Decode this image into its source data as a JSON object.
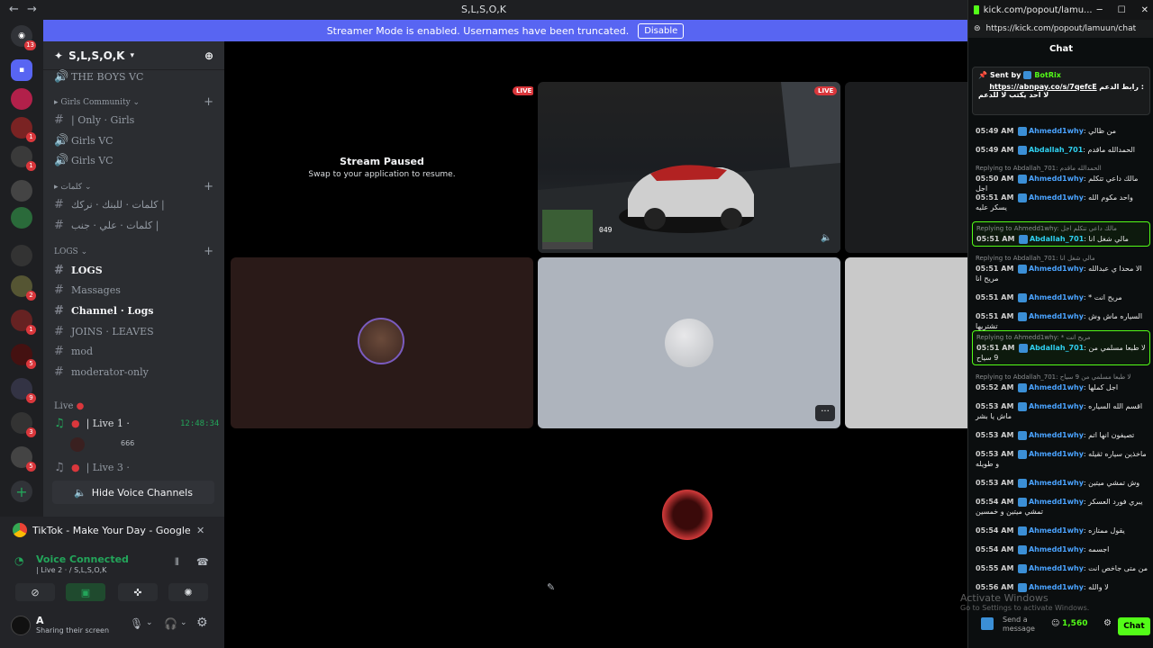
{
  "window": {
    "title": "S,L,S,O,K"
  },
  "banner": {
    "text": "Streamer Mode is enabled. Usernames have been truncated.",
    "button": "Disable"
  },
  "rail": {
    "badges": [
      "13",
      "1",
      "1",
      "1",
      "1",
      "2",
      "2",
      "1",
      "5",
      "9",
      "3",
      "5"
    ]
  },
  "server": {
    "name": "S,L,S,O,K"
  },
  "channels": {
    "boys_vc": "THE BOYS VC",
    "cat_girls": "Girls Community",
    "only_girls": "| Only · Girls",
    "girls_vc_1": "Girls VC",
    "girls_vc_2": "Girls VC",
    "cat_arabic": "كلمات",
    "arabic_1": "كلمات · للبنك · نركك |",
    "arabic_2": "كلمات · علي · جنب |",
    "cat_logs": "LOGS",
    "logs": "LOGS",
    "massages": "Massages",
    "channel_logs": "Channel · Logs",
    "joins": "JOINS · LEAVES",
    "mod": "mod",
    "moderator_only": "moderator-only",
    "cat_live": "Live",
    "live1": "| Live 1 ·",
    "live1_time": "12:48:34",
    "live1_user": "666",
    "live3": "| Live 3 ·",
    "hide_voice": "Hide Voice Channels"
  },
  "tiktok": {
    "text": "TikTok - Make Your Day - Google Ch..."
  },
  "voice": {
    "status": "Voice Connected",
    "channel": "| Live 2 · / S,L,S,O,K"
  },
  "user": {
    "name": "A",
    "status": "Sharing their screen"
  },
  "stage": {
    "paused_title": "Stream Paused",
    "paused_sub": "Swap to your application to resume.",
    "live": "LIVE",
    "speed": "049"
  },
  "kick": {
    "tab": "kick.com/popout/lamu...",
    "url": "https://kick.com/popout/lamuun/chat",
    "header": "Chat",
    "pinned_sent_by": "Sent by",
    "pinned_user": "BotRix",
    "pinned_link": "https://abnpay.co/s/7qefcE",
    "pinned_text1": "رابط الدعم :",
    "pinned_text2": "لا احد يكتب لا للدعم",
    "messages": [
      {
        "time": "05:49 AM",
        "user": "Ahmedd1why",
        "text": "من ظالي"
      },
      {
        "time": "05:49 AM",
        "user": "Abdallah_701",
        "text": "الحمدالله ماقدم"
      },
      {
        "time": "05:50 AM",
        "user": "Ahmedd1why",
        "text": "مالك داعي تتكلم اجل",
        "reply": "Replying to Abdallah_701: الحمدالله ماقدم"
      },
      {
        "time": "05:51 AM",
        "user": "Ahmedd1why",
        "text": "واحد مكوم الله يسكر عليه"
      },
      {
        "time": "05:51 AM",
        "user": "Abdallah_701",
        "text": "مالي شغل انا",
        "reply": "Replying to Ahmedd1why: مالك داعي تتكلم اجل"
      },
      {
        "time": "05:51 AM",
        "user": "Ahmedd1why",
        "text": "الا محدا ي عبدالله مريح انا",
        "reply": "Replying to Abdallah_701: مالي شغل انا"
      },
      {
        "time": "05:51 AM",
        "user": "Ahmedd1why",
        "text": "* مريح انت"
      },
      {
        "time": "05:51 AM",
        "user": "Ahmedd1why",
        "text": "السياره ماش وش تشتريها"
      },
      {
        "time": "05:51 AM",
        "user": "Abdallah_701",
        "text": "لا طبعا مسلمي من 9 سياح",
        "reply": "Replying to Ahmedd1why: * مريح انت"
      },
      {
        "time": "05:52 AM",
        "user": "Ahmedd1why",
        "text": "اجل كملها",
        "reply": "Replying to Abdallah_701: لا طبعا مسلمي من 9 سياح"
      },
      {
        "time": "05:53 AM",
        "user": "Ahmedd1why",
        "text": "اقسم الله السياره ماش يا بشر"
      },
      {
        "time": "05:53 AM",
        "user": "Ahmedd1why",
        "text": "تصيفون انها اتم"
      },
      {
        "time": "05:53 AM",
        "user": "Ahmedd1why",
        "text": "ماخذين سياره ثقيله و طويله"
      },
      {
        "time": "05:53 AM",
        "user": "Ahmedd1why",
        "text": "وش تمشي ميتين"
      },
      {
        "time": "05:54 AM",
        "user": "Ahmedd1why",
        "text": "يبري فورد العسكر تمشي ميتين و خمسين"
      },
      {
        "time": "05:54 AM",
        "user": "Ahmedd1why",
        "text": "يقول ممتازه"
      },
      {
        "time": "05:54 AM",
        "user": "Ahmedd1why",
        "text": "اجسمه"
      },
      {
        "time": "05:55 AM",
        "user": "Ahmedd1why",
        "text": "من متى جاخص انت"
      },
      {
        "time": "05:56 AM",
        "user": "Ahmedd1why",
        "text": "لا والله"
      }
    ],
    "send_placeholder": "Send a message",
    "points": "1,560",
    "chat_button": "Chat"
  },
  "watermark": {
    "title": "Activate Windows",
    "sub": "Go to Settings to activate Windows."
  },
  "colors": {
    "blurple": "#5865f2",
    "kick_green": "#53fc18",
    "live_red": "#da373c",
    "abdallah": "#2fd0f0",
    "ahmed": "#4aa3ff"
  }
}
